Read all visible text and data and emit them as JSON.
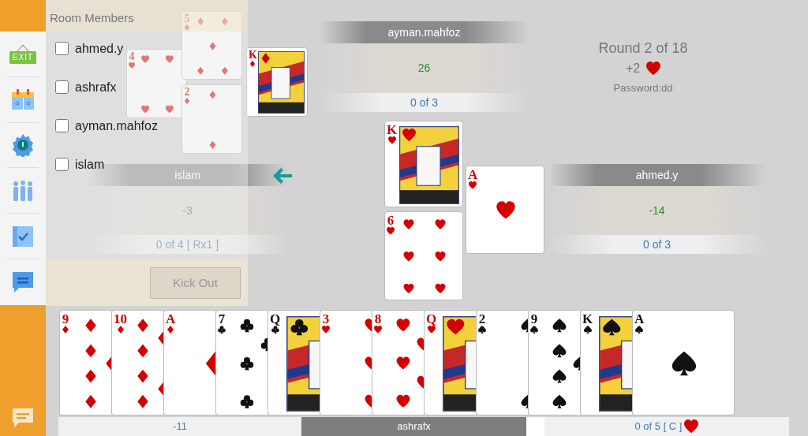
{
  "sidebar": {
    "items": [
      {
        "kind": "exit",
        "label": "EXIT"
      },
      {
        "kind": "calendar"
      },
      {
        "kind": "settings"
      },
      {
        "kind": "people"
      },
      {
        "kind": "checklist"
      },
      {
        "kind": "chat"
      }
    ],
    "footer_item": {
      "kind": "chat"
    }
  },
  "room_members": {
    "title": "Room Members",
    "members": [
      {
        "name": "ahmed.y",
        "checked": false
      },
      {
        "name": "ashrafx",
        "checked": false
      },
      {
        "name": "ayman.mahfoz",
        "checked": false
      },
      {
        "name": "islam",
        "checked": false
      }
    ],
    "kick_button": {
      "label": "Kick Out",
      "disabled": true
    }
  },
  "round_info": {
    "title": "Round 2 of 18",
    "bid": {
      "value": "+2",
      "kind": "hearts"
    },
    "password": "Password:dd"
  },
  "players": [
    {
      "kind": "top",
      "name": "ayman.mahfoz",
      "score": "26",
      "tricks": "0 of 3",
      "turn": false
    },
    {
      "kind": "left",
      "name": "islam",
      "score": "-3",
      "tricks": "0 of 4 [ Rx1 ]",
      "turn": true
    },
    {
      "kind": "right",
      "name": "ahmed.y",
      "score": "-14",
      "tricks": "0 of 3",
      "turn": false
    },
    {
      "kind": "bottom",
      "name": "ashrafx",
      "score": "-11",
      "tricks": "0 of 5 [ C ]",
      "tricks_icon": {
        "kind": "hearts"
      },
      "turn": false
    }
  ],
  "last_trick": [
    {
      "rank": "4",
      "kind": "hearts"
    },
    {
      "rank": "5",
      "kind": "diamonds"
    },
    {
      "rank": "2",
      "kind": "diamonds"
    },
    {
      "rank": "K",
      "kind": "diamonds"
    }
  ],
  "current_trick": [
    {
      "rank": "K",
      "kind": "hearts"
    },
    {
      "rank": "6",
      "kind": "hearts"
    },
    {
      "rank": "A",
      "kind": "hearts"
    }
  ],
  "hand": [
    {
      "rank": "9",
      "kind": "diamonds"
    },
    {
      "rank": "10",
      "kind": "diamonds"
    },
    {
      "rank": "A",
      "kind": "diamonds"
    },
    {
      "rank": "7",
      "kind": "clubs"
    },
    {
      "rank": "Q",
      "kind": "clubs"
    },
    {
      "rank": "3",
      "kind": "hearts"
    },
    {
      "rank": "8",
      "kind": "hearts"
    },
    {
      "rank": "Q",
      "kind": "hearts"
    },
    {
      "rank": "2",
      "kind": "spades"
    },
    {
      "rank": "9",
      "kind": "spades"
    },
    {
      "rank": "K",
      "kind": "spades"
    },
    {
      "rank": "A",
      "kind": "spades"
    }
  ]
}
